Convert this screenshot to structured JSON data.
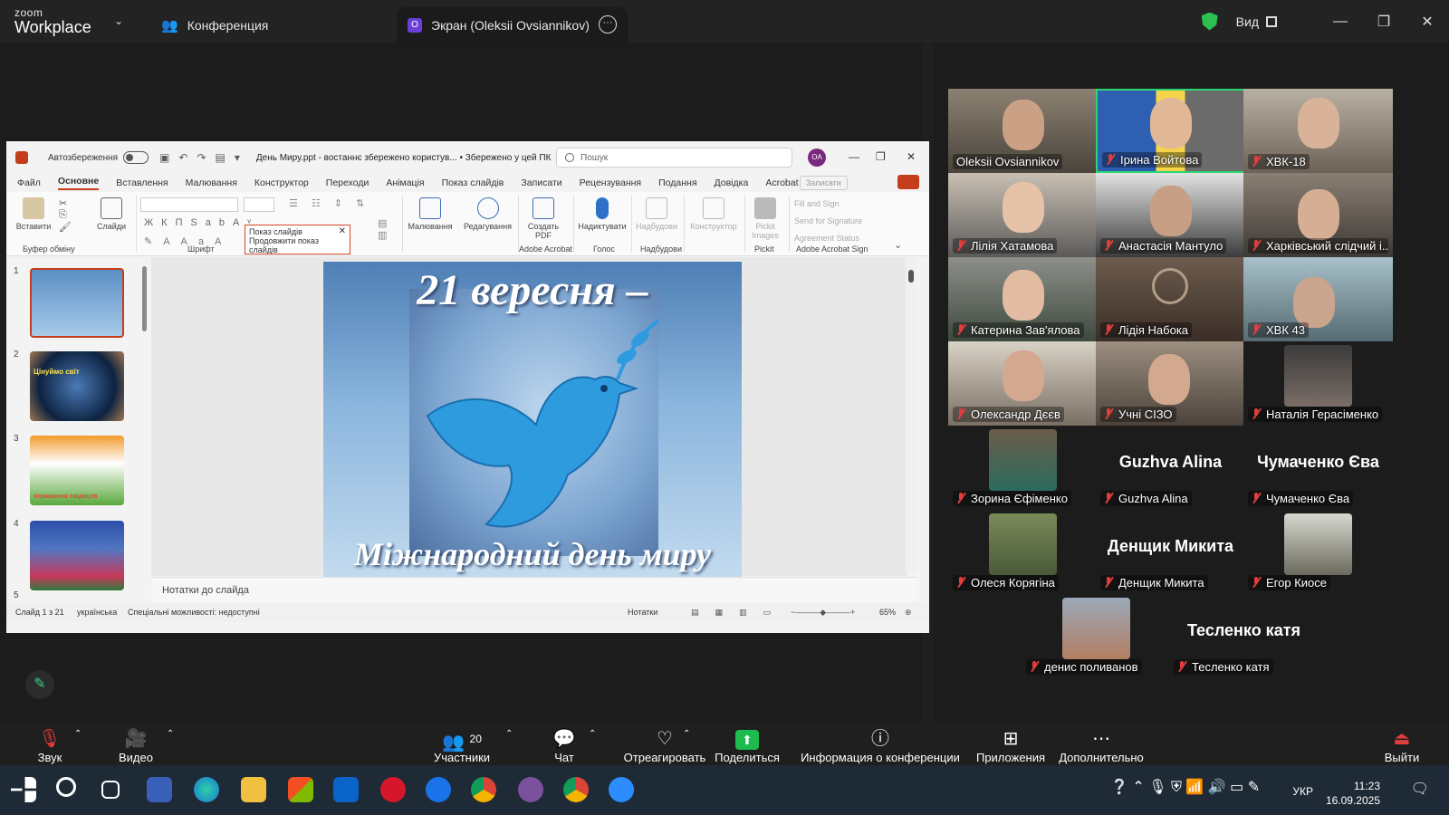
{
  "zoom": {
    "logo_line1": "zoom",
    "logo_line2": "Workplace",
    "tab_conference": "Конференция",
    "tab_screen_badge": "O",
    "tab_screen": "Экран (Oleksii Ovsiannikov)",
    "view_label": "Вид"
  },
  "ppt": {
    "autosave_label": "Автозбереження",
    "doc_name": "День Миру.ppt  -  востаннє збережено користув... • Збережено у цей ПК",
    "search_placeholder": "Пошук",
    "avatar_initials": "OA",
    "tabs": [
      "Файл",
      "Основне",
      "Вставлення",
      "Малювання",
      "Конструктор",
      "Переходи",
      "Анімація",
      "Показ слайдів",
      "Записати",
      "Рецензування",
      "Подання",
      "Довідка",
      "Acrobat"
    ],
    "record_label": "Записати",
    "ribbon": {
      "paste": "Вставити",
      "slides": "Слайди",
      "clipboard": "Буфер обміну",
      "font": "Шрифт",
      "drawing": "Малювання",
      "editing": "Редагування",
      "create_pdf": "Создать PDF",
      "dictate": "Надиктувати",
      "addins": "Надбудови",
      "designer": "Конструктор",
      "pickit": "Pickit Images",
      "adobe_acrobat": "Adobe Acrobat",
      "voice": "Голос",
      "addins_group": "Надбудови",
      "pickit_group": "Pickit",
      "fill_sign": "Fill and Sign",
      "send_signature": "Send for Signature",
      "agreement_status": "Agreement Status",
      "acrobat_sign": "Adobe Acrobat Sign"
    },
    "popup_line1": "Показ слайдів",
    "popup_line2": "Продовжити показ слайдів",
    "slide_numbers": [
      "1",
      "2",
      "3",
      "4",
      "5"
    ],
    "slide_title": "21  вересня –",
    "slide_subtitle": "Міжнародний день миру",
    "thumb2_text": "Цінуймо світ",
    "thumb3_text": "отримання свідоцтв",
    "notes_placeholder": "Нотатки до слайда",
    "status_slide": "Слайд 1 з 21",
    "status_lang": "українська",
    "status_access": "Спеціальні можливості: недоступні",
    "status_notes": "Нотатки",
    "zoom_level": "65%"
  },
  "participants": [
    {
      "name": "Oleksii Ovsiannikov",
      "muted": false
    },
    {
      "name": "Ірина Войтова",
      "muted": true,
      "selected": true
    },
    {
      "name": "ХВК-18",
      "muted": true
    },
    {
      "name": "Лілія Хатамова",
      "muted": true
    },
    {
      "name": "Анастасія Мантуло",
      "muted": true
    },
    {
      "name": "Харківський слідчий і...",
      "muted": true
    },
    {
      "name": "Катерина Зав'ялова",
      "muted": true
    },
    {
      "name": "Лідія Набока",
      "muted": true
    },
    {
      "name": "ХВК 43",
      "muted": true
    },
    {
      "name": "Олександр Дєєв",
      "muted": true
    },
    {
      "name": "Учні СІЗО",
      "muted": true
    },
    {
      "name": "Наталія Герасіменко",
      "muted": true
    },
    {
      "name": "Зорина Єфіменко",
      "muted": true
    },
    {
      "name": "Guzhva Alina",
      "muted": true,
      "big": "Guzhva Alina"
    },
    {
      "name": "Чумаченко Єва",
      "muted": true,
      "big": "Чумаченко Єва"
    },
    {
      "name": "Олеся Корягіна",
      "muted": true
    },
    {
      "name": "Денщик Микита",
      "muted": true,
      "big": "Денщик Микита"
    },
    {
      "name": "Егор Киосе",
      "muted": true
    },
    {
      "name": "денис поливанов",
      "muted": true
    },
    {
      "name": "Тесленко катя",
      "muted": true,
      "big": "Тесленко катя"
    }
  ],
  "toolbar": {
    "audio": "Звук",
    "video": "Видео",
    "participants": "Участники",
    "participants_count": "20",
    "chat": "Чат",
    "react": "Отреагировать",
    "share": "Поделиться",
    "info": "Информация о конференции",
    "apps": "Приложения",
    "more": "Дополнительно",
    "leave": "Выйти"
  },
  "taskbar": {
    "lang": "УКР",
    "time": "11:23",
    "date": "16.09.2025"
  }
}
